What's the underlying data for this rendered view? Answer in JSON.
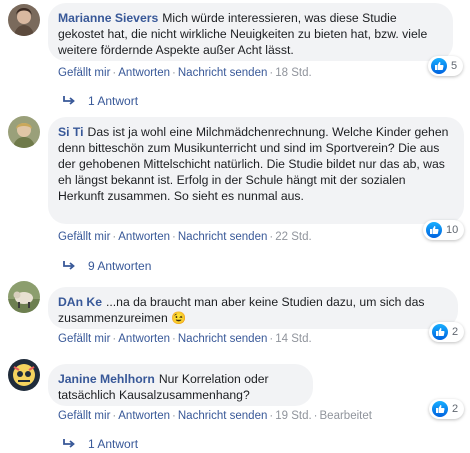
{
  "comments": [
    {
      "author": "Marianne Sievers",
      "text": "Mich würde interessieren, was diese Studie gekostet hat, die nicht wirkliche Neuigkeiten zu bieten hat, bzw. viele weitere fördernde Aspekte außer Acht lässt.",
      "reactions": "5",
      "like": "Gefällt mir",
      "reply": "Antworten",
      "message": "Nachricht senden",
      "time": "18 Std.",
      "replies": "1 Antwort"
    },
    {
      "author": "Si Ti",
      "text": "Das ist ja wohl eine Milchmädchenrechnung. Welche Kinder gehen denn bitteschön zum Musikunterricht und sind im Sportverein? Die aus der gehobenen Mittelschicht natürlich. Die Studie bildet nur das ab, was eh längst bekannt ist. Erfolg in der Schule hängt mit der sozialen Herkunft zusammen. So sieht es nunmal aus.",
      "reactions": "10",
      "like": "Gefällt mir",
      "reply": "Antworten",
      "message": "Nachricht senden",
      "time": "22 Std.",
      "replies": "9 Antworten"
    },
    {
      "author": "DAn Ke",
      "text": "...na da braucht man aber keine Studien dazu, um sich das zusammenzureimen",
      "emoji": "😉",
      "reactions": "2",
      "like": "Gefällt mir",
      "reply": "Antworten",
      "message": "Nachricht senden",
      "time": "14 Std."
    },
    {
      "author": "Janine Mehlhorn",
      "text": "Nur Korrelation oder tatsächlich Kausalzusammenhang?",
      "reactions": "2",
      "like": "Gefällt mir",
      "reply": "Antworten",
      "message": "Nachricht senden",
      "time": "19 Std.",
      "edited": "Bearbeitet",
      "replies": "1 Antwort"
    }
  ],
  "icons": {
    "like": "thumbs-up-icon",
    "reply_arrow": "reply-arrow-icon"
  },
  "colors": {
    "link": "#385898",
    "bubble": "#f2f3f5",
    "muted": "#90949c",
    "like_badge": "#1877f2"
  }
}
